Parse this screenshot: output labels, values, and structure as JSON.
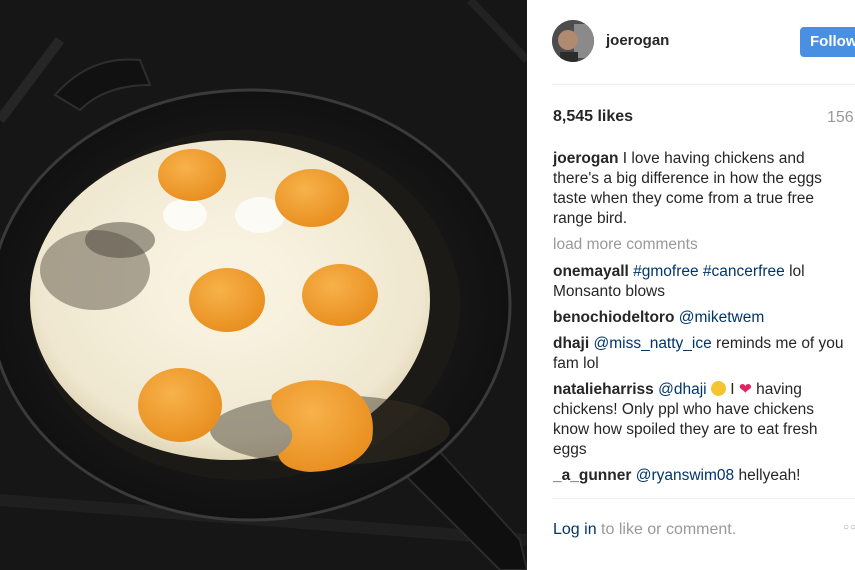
{
  "post": {
    "username": "joerogan",
    "follow_label": "Follow",
    "likes": "8,545 likes",
    "time": "156",
    "caption": {
      "author": "joerogan",
      "text": " I love having chickens and there's a big difference in how the eggs taste when they come from a true free range bird."
    },
    "load_more": "load more comments",
    "comments": [
      {
        "author": "onemayall",
        "parts": [
          " ",
          "#gmofree",
          " ",
          "#cancerfree",
          " lol Monsanto blows"
        ]
      },
      {
        "author": "benochiodeltoro",
        "parts": [
          " ",
          "@miketwem"
        ]
      },
      {
        "author": "dhaji",
        "parts": [
          " ",
          "@miss_natty_ice",
          " reminds me of you fam lol"
        ]
      },
      {
        "author": "natalieharriss",
        "parts": [
          " ",
          "@dhaji",
          " ",
          " I ",
          " having chickens! Only ppl who have chickens know how spoiled they are to eat fresh eggs"
        ]
      },
      {
        "author": "_a_gunner",
        "parts": [
          " ",
          "@ryanswim08",
          " hellyeah!"
        ]
      }
    ],
    "login_link": "Log in",
    "login_text": " to like or comment.",
    "more_icon_glyph": "○○"
  },
  "icons": {
    "heart": "heart-emoji",
    "wink": "wink-emoji",
    "more": "more-options-icon"
  },
  "colors": {
    "follow_bg": "#4a90e2",
    "link": "#003569",
    "muted": "#999999"
  }
}
